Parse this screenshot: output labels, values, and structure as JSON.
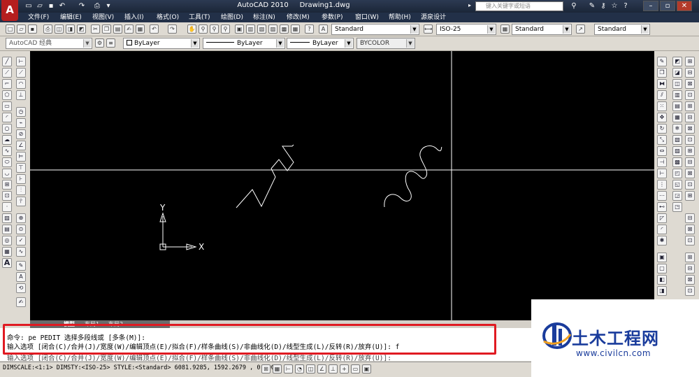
{
  "title_bar": {
    "app_name": "AutoCAD 2010",
    "file_name": "Drawing1.dwg",
    "search_placeholder": "键入关键字或短语",
    "app_button_label": "A"
  },
  "menu": [
    "文件(F)",
    "编辑(E)",
    "视图(V)",
    "插入(I)",
    "格式(O)",
    "工具(T)",
    "绘图(D)",
    "标注(N)",
    "修改(M)",
    "参数(P)",
    "窗口(W)",
    "帮助(H)",
    "源泉设计"
  ],
  "style_toolbar": {
    "text_style": "Standard",
    "dim_style": "ISO-25",
    "table_style": "Standard",
    "multileader_style": "Standard"
  },
  "layer_toolbar": {
    "workspace": "AutoCAD 经典",
    "layer": "ByLayer",
    "linetype": "ByLayer",
    "lineweight": "ByLayer",
    "plot_style": "BYCOLOR"
  },
  "ucs": {
    "x_label": "X",
    "y_label": "Y"
  },
  "layout_tabs": [
    "模型",
    "布局1",
    "布局2"
  ],
  "command": {
    "line1": "命令: pe PEDIT 选择多段线或 [多条(M)]:",
    "line2": "输入选项 [闭合(C)/合并(J)/宽度(W)/编辑顶点(E)/拟合(F)/样条曲线(S)/非曲线化(D)/线型生成(L)/反转(R)/放弃(U)]: f",
    "line3": "输入选项 [闭合(C)/合并(J)/宽度(W)/编辑顶点(E)/拟合(F)/样条曲线(S)/非曲线化(D)/线型生成(L)/反转(R)/放弃(U)]:"
  },
  "status_bar": {
    "text": "DIMSCALE:<1:1> DIMSTY:<ISO-25> STYLE:<Standard>  6081.9285, 1592.2679 , 0.0000"
  },
  "watermark": {
    "title": "土木工程网",
    "url": "www.civilcn.com"
  },
  "colors": {
    "highlight": "#e01a22",
    "canvas": "#000000",
    "watermark_blue": "#1a3c9c"
  }
}
